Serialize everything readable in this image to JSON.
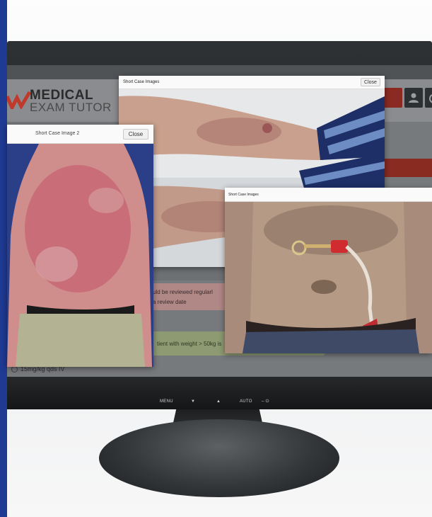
{
  "app": {
    "logo_line1": "MEDICAL",
    "logo_line2": "EXAM TUTOR",
    "logo_mark_icon": "checkmark-logo-icon",
    "header_icons": [
      "user-icon",
      "power-icon"
    ],
    "colors": {
      "brand_red": "#c0392b",
      "page_frame": "#1f3a93",
      "screen_gray": "#777a7d"
    }
  },
  "background_content": {
    "alert_line1": "uld be reviewed regularl",
    "alert_line2": "a review date",
    "green_text": "tient with weight > 50kg is",
    "radio_option": "15mg/kg qds IV"
  },
  "monitor": {
    "controls": [
      "MENU",
      "▼",
      "▲",
      "AUTO",
      "– ⏻"
    ]
  },
  "dialogs": {
    "back": {
      "title": "Short Case Images",
      "close_label": "Close"
    },
    "left": {
      "title": "Short Case Image 2",
      "close_label": "Close"
    },
    "right": {
      "title": "Short Case Images"
    }
  }
}
